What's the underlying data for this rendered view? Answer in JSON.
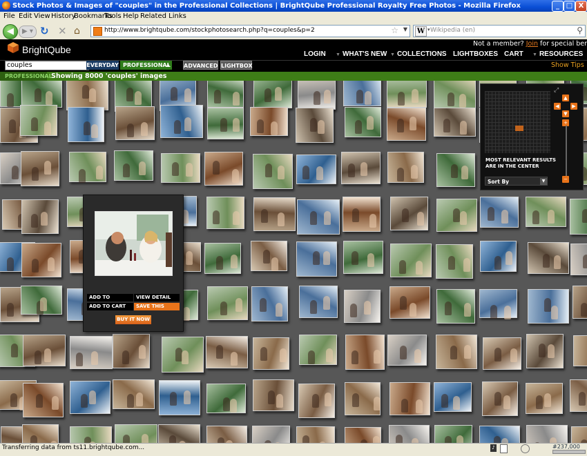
{
  "window": {
    "title": "Stock Photos & Images of \"couples\" in the Professional Collections | BrightQube Professional Royalty Free Photos - Mozilla Firefox",
    "minimize": "_",
    "maximize": "□",
    "close": "X"
  },
  "menu": [
    "File",
    "Edit",
    "View",
    "History",
    "Bookmarks",
    "Tools",
    "Help",
    "Related Links"
  ],
  "browser": {
    "url": "http://www.brightqube.com/stockphotosearch.php?q=couples&p=2",
    "search_placeholder": "Wikipedia (en)"
  },
  "site": {
    "logo": "BrightQube",
    "member_prefix": "Not a member?",
    "join": "Join",
    "member_suffix": "for special benefits",
    "nav": [
      "LOGIN",
      "WHAT'S NEW",
      "COLLECTIONS",
      "LIGHTBOXES",
      "CART",
      "RESOURCES"
    ],
    "search_value": "couples",
    "tab_everyday": "EVERYDAY",
    "tab_professional": "PROFESSIONAL",
    "advanced": "ADVANCED",
    "lightbox": "LIGHTBOX",
    "show_tips": "Show Tips",
    "collection_label": "PROFESSIONAL",
    "result_text": "Showing 8000 'couples' images"
  },
  "navigator": {
    "caption_line1": "MOST RELEVANT RESULTS",
    "caption_line2": "ARE IN THE CENTER",
    "sort_by": "Sort By"
  },
  "popup": {
    "add_to_lightbox": "ADD TO LIGHTBOX",
    "view_detail": "VIEW DETAIL",
    "add_to_cart": "ADD TO CART",
    "save_this": "SAVE THIS",
    "buy_it_now": "BUY IT NOW"
  },
  "status": {
    "text": "Transferring data from ts11.brightqube.com...",
    "ticker": "#237,000"
  },
  "colors": {
    "accent_orange": "#e8731a",
    "pro_green": "#2f7c1b",
    "everyday_blue": "#1a3b63"
  }
}
